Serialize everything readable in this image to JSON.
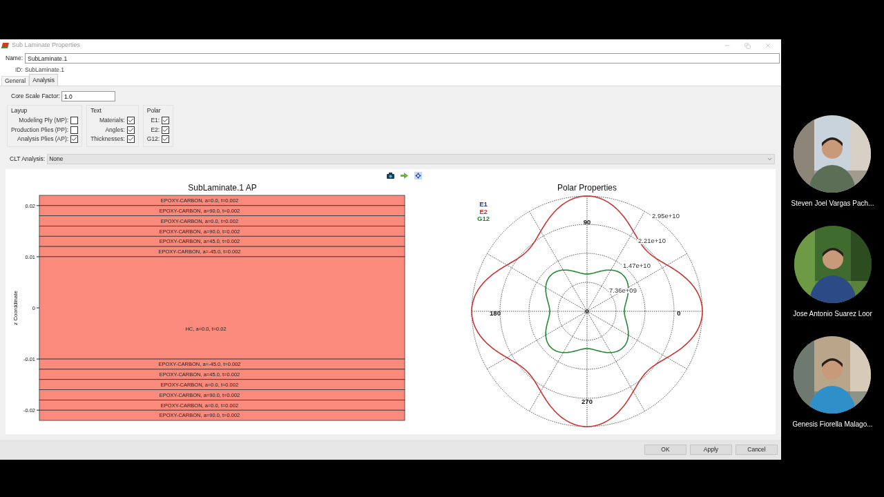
{
  "window": {
    "title": "Sub Laminate Properties"
  },
  "name_field": {
    "label": "Name:",
    "value": "SubLaminate.1"
  },
  "id_field": {
    "label": "ID:",
    "value": "SubLaminate.1"
  },
  "tabs": [
    {
      "label": "General",
      "selected": false
    },
    {
      "label": "Analysis",
      "selected": true
    }
  ],
  "core_scale_factor": {
    "label": "Core Scale Factor:",
    "value": "1.0"
  },
  "groups": [
    {
      "title": "Layup",
      "options": [
        {
          "label": "Modeling Ply (MP):",
          "checked": false
        },
        {
          "label": "Production Plies (PP):",
          "checked": false
        },
        {
          "label": "Analysis Plies (AP):",
          "checked": true
        }
      ]
    },
    {
      "title": "Text",
      "options": [
        {
          "label": "Materials:",
          "checked": true
        },
        {
          "label": "Angles:",
          "checked": true
        },
        {
          "label": "Thicknesses:",
          "checked": true
        }
      ]
    },
    {
      "title": "Polar",
      "options": [
        {
          "label": "E1:",
          "checked": true
        },
        {
          "label": "E2:",
          "checked": true
        },
        {
          "label": "G12:",
          "checked": true
        }
      ]
    }
  ],
  "clt_analysis": {
    "label": "CLT Analysis:",
    "value": "None"
  },
  "layup_plot": {
    "title": "SubLaminate.1 AP",
    "ylabel": "z Coorddinate",
    "yticks": [
      "0.02",
      "0.01",
      "0",
      "-0.01",
      "-0.02"
    ],
    "layers": [
      {
        "kind": "ply",
        "label": "EPOXY-CARBON, a=0.0, t=0.002"
      },
      {
        "kind": "ply",
        "label": "EPOXY-CARBON, a=90.0, t=0.002"
      },
      {
        "kind": "ply",
        "label": "EPOXY-CARBON, a=0.0, t=0.002"
      },
      {
        "kind": "ply",
        "label": "EPOXY-CARBON, a=90.0, t=0.002"
      },
      {
        "kind": "ply",
        "label": "EPOXY-CARBON, a=45.0, t=0.002"
      },
      {
        "kind": "ply",
        "label": "EPOXY-CARBON, a=-45.0, t=0.002"
      },
      {
        "kind": "core",
        "label": "HC, a=0.0, t=0.02"
      },
      {
        "kind": "ply",
        "label": "EPOXY-CARBON, a=-45.0, t=0.002"
      },
      {
        "kind": "ply",
        "label": "EPOXY-CARBON, a=45.0, t=0.002"
      },
      {
        "kind": "ply",
        "label": "EPOXY-CARBON, a=0.0, t=0.002"
      },
      {
        "kind": "ply",
        "label": "EPOXY-CARBON, a=90.0, t=0.002"
      },
      {
        "kind": "ply",
        "label": "EPOXY-CARBON, a=0.0, t=0.002"
      },
      {
        "kind": "ply",
        "label": "EPOXY-CARBON, a=90.0, t=0.002"
      }
    ]
  },
  "polar_plot": {
    "title": "Polar Properties",
    "legend": [
      {
        "label": "E1",
        "color": "#2233bb"
      },
      {
        "label": "E2",
        "color": "#cc3333"
      },
      {
        "label": "G12",
        "color": "#228833"
      }
    ],
    "angle_labels": [
      "90",
      "0",
      "180",
      "270"
    ],
    "radial_labels": [
      "2.95e+10",
      "2.21e+10",
      "1.47e+10",
      "7.36e+09"
    ]
  },
  "buttons": [
    "OK",
    "Apply",
    "Cancel"
  ],
  "participants": [
    {
      "name": "Steven Joel Vargas Pach..."
    },
    {
      "name": "Jose Antonio Suarez Loor"
    },
    {
      "name": "Genesis Fiorella Malago..."
    }
  ]
}
